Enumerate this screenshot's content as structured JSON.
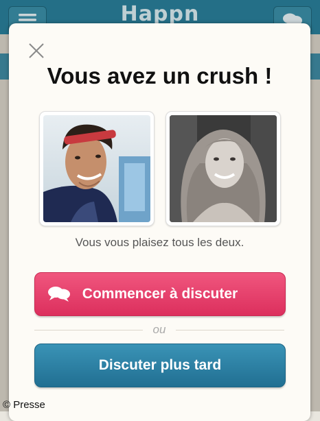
{
  "app": {
    "brand": "Happn",
    "menu_icon": "hamburger-menu-icon",
    "chat_icon": "chat-bubbles-icon"
  },
  "modal": {
    "title": "Vous avez un crush !",
    "close_icon": "close-icon",
    "photos": [
      {
        "label": "photo-man",
        "style": "color"
      },
      {
        "label": "photo-woman",
        "style": "black-and-white"
      }
    ],
    "subtitle": "Vous vous plaisez tous les deux.",
    "primary_button": {
      "label": "Commencer à discuter",
      "icon": "chat-bubbles-icon",
      "color": "#e63e6a"
    },
    "separator": "ou",
    "secondary_button": {
      "label": "Discuter plus tard",
      "color": "#2b7fa3"
    }
  },
  "credit": "© Presse"
}
